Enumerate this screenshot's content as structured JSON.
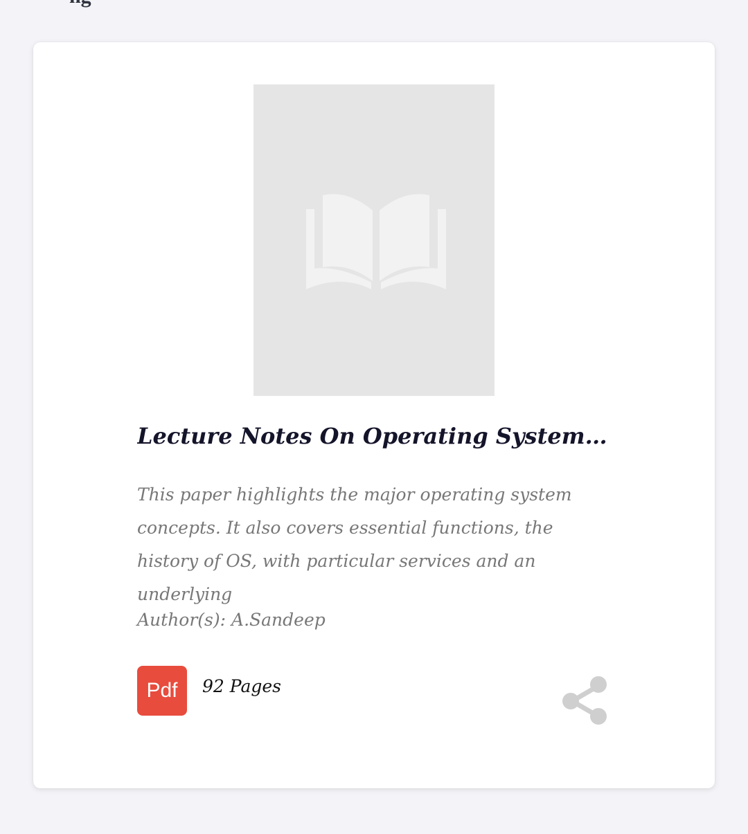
{
  "header": {
    "partial_text": "ng"
  },
  "card": {
    "cover_icon": "open-book-icon",
    "title": "Lecture Notes On Operating System by ...",
    "description": "This paper highlights the major operating system concepts. It also covers essential functions, the history of OS, with particular services and an underlying",
    "authors": "Author(s): A.Sandeep",
    "file_type_label": "Pdf",
    "pages": "92 Pages",
    "share_icon": "share-icon"
  },
  "colors": {
    "background": "#f4f4f8",
    "card": "#ffffff",
    "pdf_badge": "#e84c3d",
    "cover_placeholder": "#e5e5e5",
    "muted_text": "#777777"
  }
}
